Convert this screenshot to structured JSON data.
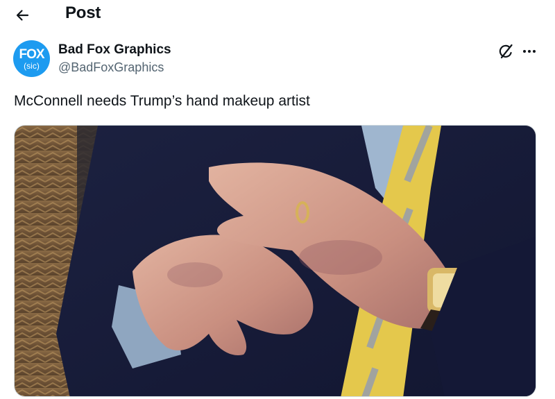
{
  "header": {
    "title": "Post",
    "back_icon": "arrow-left-icon"
  },
  "author": {
    "display_name": "Bad Fox Graphics",
    "handle": "@BadFoxGraphics",
    "avatar_main": "FOX",
    "avatar_sub": "(sic)",
    "avatar_color": "#1d9bf0"
  },
  "actions": {
    "grok_icon": "grok-icon",
    "more_icon": "more-horizontal-icon"
  },
  "tweet": {
    "text": "McConnell needs Trump’s hand makeup artist"
  },
  "colors": {
    "text_primary": "#0f1419",
    "text_secondary": "#536471",
    "border": "#cfd9de"
  }
}
